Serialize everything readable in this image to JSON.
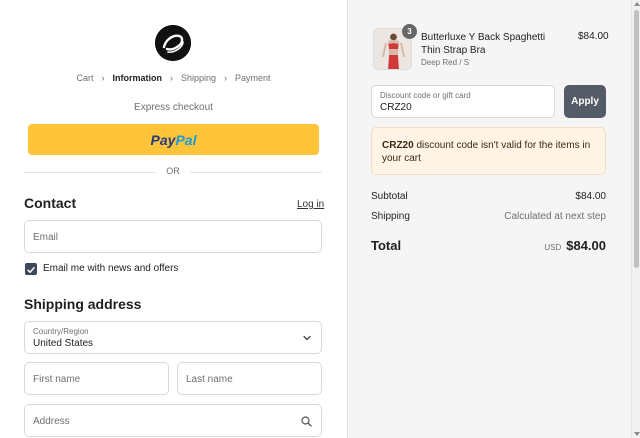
{
  "breadcrumb": {
    "cart": "Cart",
    "information": "Information",
    "shipping": "Shipping",
    "payment": "Payment"
  },
  "express": {
    "label": "Express checkout",
    "paypal_part1": "Pay",
    "paypal_part2": "Pal",
    "or": "OR"
  },
  "contact": {
    "heading": "Contact",
    "login": "Log in",
    "email_placeholder": "Email",
    "newsletter_label": "Email me with news and offers",
    "newsletter_checked": true
  },
  "shipping_address": {
    "heading": "Shipping address",
    "country_label": "Country/Region",
    "country_value": "United States",
    "first_name_placeholder": "First name",
    "last_name_placeholder": "Last name",
    "address_placeholder": "Address"
  },
  "order": {
    "product": {
      "name": "Butterluxe Y Back Spaghetti Thin Strap Bra",
      "variant": "Deep Red / S",
      "price": "$84.00",
      "quantity": "3"
    },
    "discount": {
      "label": "Discount code or gift card",
      "value": "CRZ20",
      "apply": "Apply"
    },
    "alert": {
      "code": "CRZ20",
      "message": " discount code isn't valid for the items in your cart"
    },
    "subtotal_label": "Subtotal",
    "subtotal_value": "$84.00",
    "shipping_label": "Shipping",
    "shipping_value": "Calculated at next step",
    "total_label": "Total",
    "currency": "USD",
    "total_value": "$84.00"
  },
  "colors": {
    "paypal_yellow": "#ffc439",
    "apply_button": "#545b66",
    "alert_bg": "#fff4e5",
    "checkbox": "#3a4a5c"
  }
}
